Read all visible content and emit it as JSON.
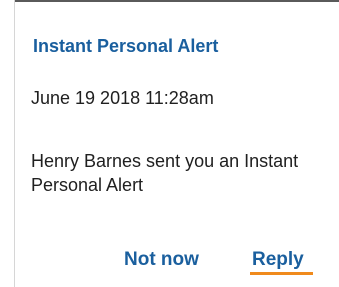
{
  "alert": {
    "title": "Instant Personal Alert",
    "date": "June 19 2018 11:28am",
    "message": "Henry Barnes sent you an Instant Personal Alert"
  },
  "actions": {
    "not_now_label": "Not now",
    "reply_label": "Reply"
  },
  "colors": {
    "accent": "#1a5f9e",
    "focus_underline": "#f08a1c",
    "body_text": "#202020"
  }
}
